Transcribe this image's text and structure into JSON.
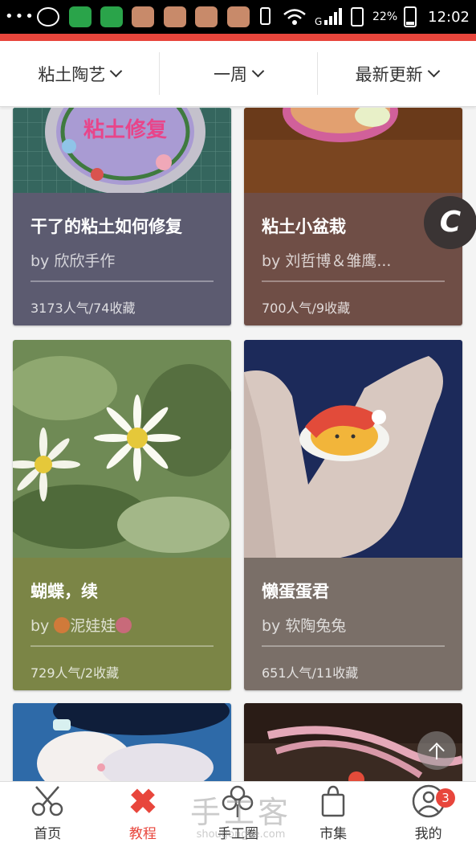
{
  "status_bar": {
    "battery": "22%",
    "time": "12:02",
    "signal_text": "G"
  },
  "filters": [
    {
      "label": "粘土陶艺"
    },
    {
      "label": "一周"
    },
    {
      "label": "最新更新"
    }
  ],
  "cards": [
    {
      "title": "干了的粘土如何修复",
      "author": "by 欣欣手作",
      "stats": "3173人气/74收藏",
      "color": "#5c5b70",
      "image_text": "粘土修复"
    },
    {
      "title": "粘土小盆栽",
      "author": "by 刘哲博＆雏鹰...",
      "stats": "700人气/9收藏",
      "color": "#6f4e46"
    },
    {
      "title": "蝴蝶，续",
      "author_prefix": "by",
      "author_name": "泥娃娃",
      "stats": "729人气/2收藏",
      "color": "#7b8546"
    },
    {
      "title": "懒蛋蛋君",
      "author": "by 软陶兔兔",
      "stats": "651人气/11收藏",
      "color": "#7a6f68"
    }
  ],
  "float_button": {
    "label": "C"
  },
  "tabs": [
    {
      "label": "首页",
      "icon": "scissors-icon",
      "active": false
    },
    {
      "label": "教程",
      "icon": "pencil-ruler-icon",
      "active": true
    },
    {
      "label": "手工圈",
      "icon": "flower-icon",
      "active": false
    },
    {
      "label": "市集",
      "icon": "shopping-bag-icon",
      "active": false
    },
    {
      "label": "我的",
      "icon": "user-icon",
      "active": false,
      "badge": "3"
    }
  ],
  "watermark": {
    "line1": "手工客",
    "line2": "shougongke.com"
  },
  "colors": {
    "accent": "#e8463c"
  }
}
